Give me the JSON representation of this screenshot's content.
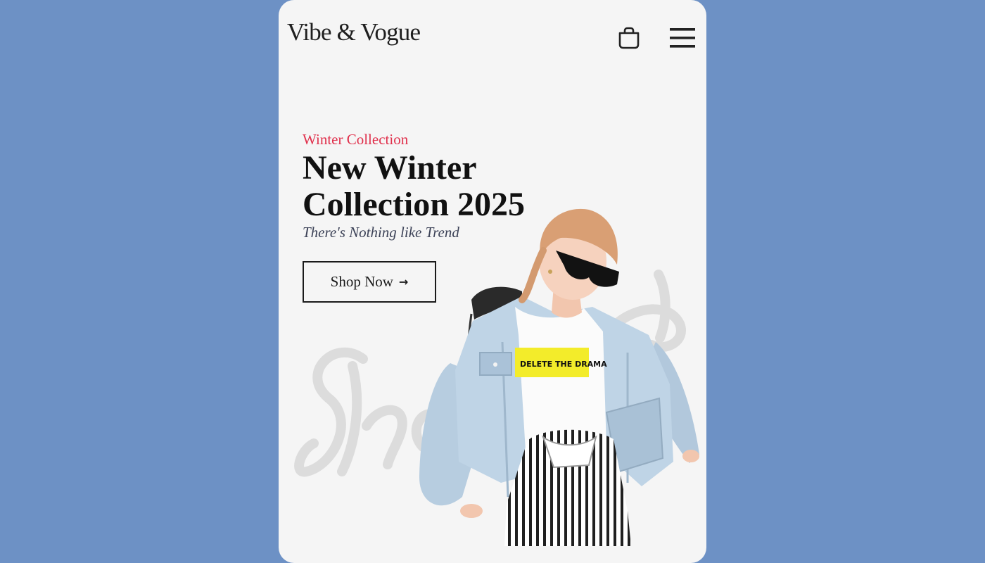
{
  "app": {
    "brand": "Vibe & Vogue"
  },
  "header": {
    "cart_icon": "shopping-bag-icon",
    "menu_icon": "hamburger-menu-icon"
  },
  "hero": {
    "eyebrow": "Winter Collection",
    "headline": "New Winter Collection 2025",
    "tagline": "There's Nothing like Trend",
    "cta_label": "Shop Now",
    "cta_icon": "arrow-right-icon",
    "image": "model-denim-jacket",
    "tshirt_print": "DELETE THE DRAMA"
  },
  "colors": {
    "background": "#6d91c5",
    "card": "#f5f5f5",
    "accent": "#e0304c",
    "text": "#111111",
    "tagline": "#3c4257"
  }
}
